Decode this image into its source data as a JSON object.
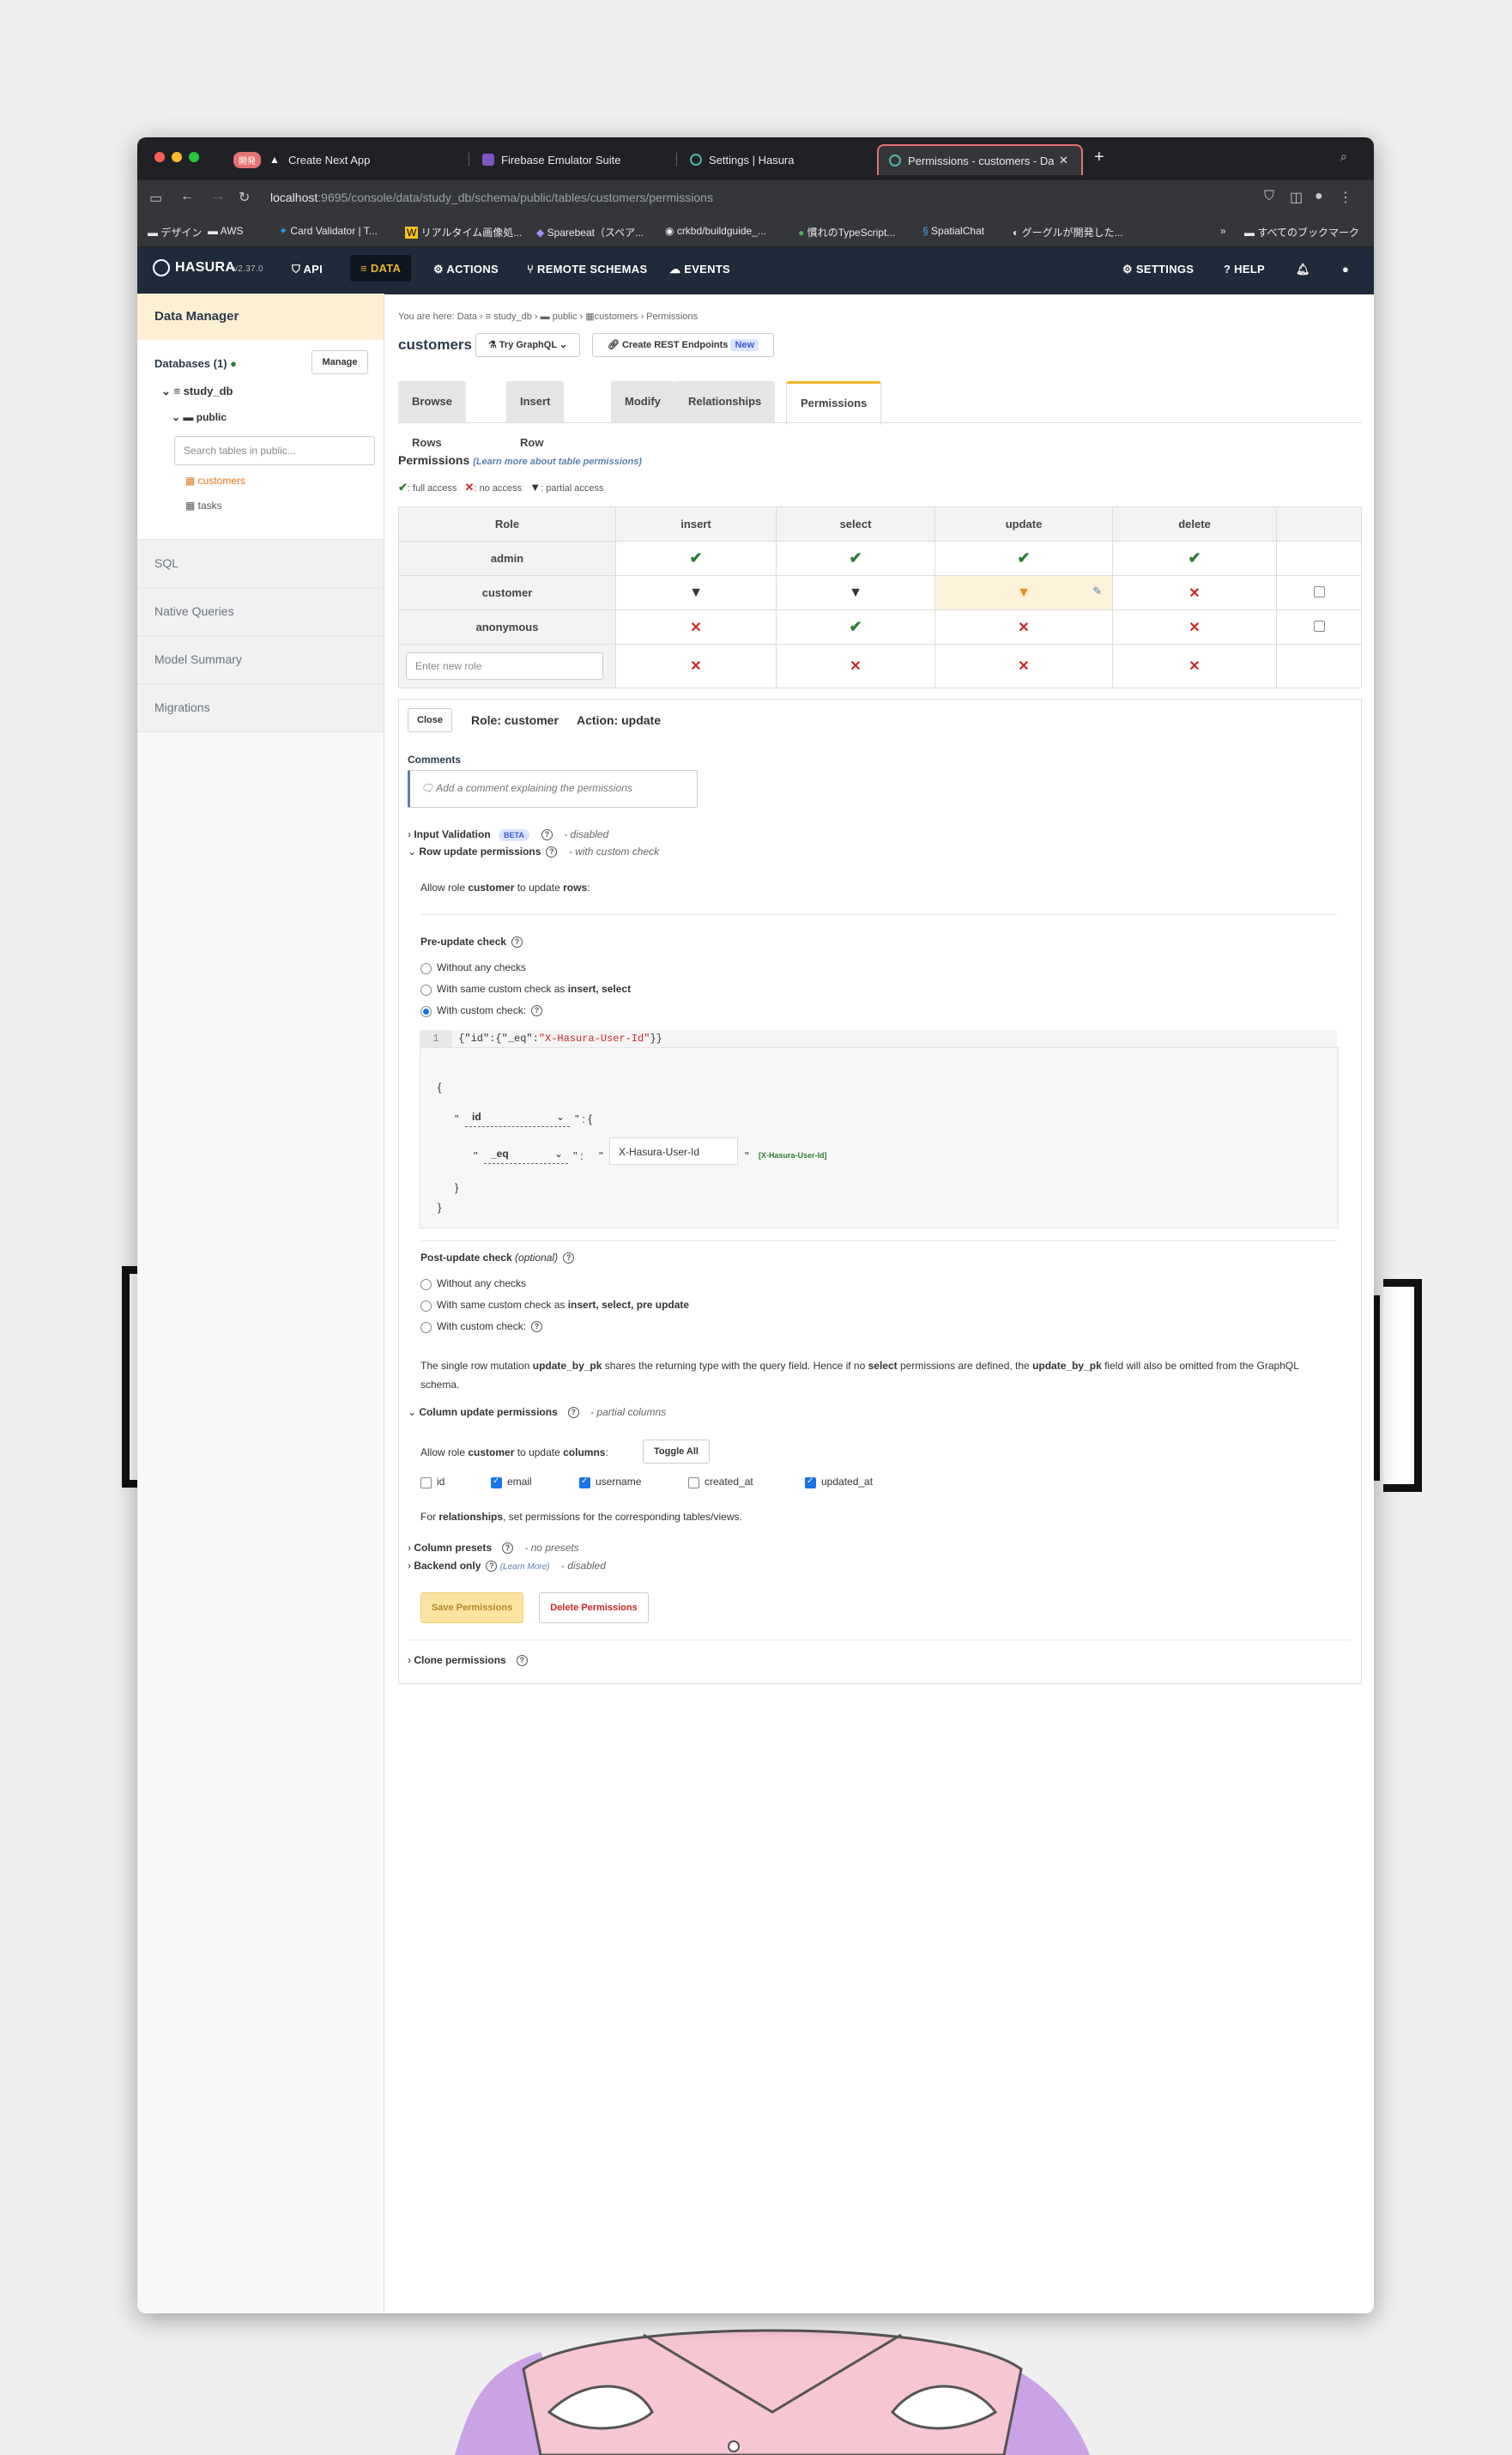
{
  "browser": {
    "tabs": [
      {
        "badge": "開発",
        "label": "Create Next App"
      },
      {
        "label": "Firebase Emulator Suite"
      },
      {
        "label": "Settings | Hasura"
      },
      {
        "label": "Permissions - customers - Da"
      }
    ],
    "new_tab": "+",
    "url_host": "localhost",
    "url_path": ":9695/console/data/study_db/schema/public/tables/customers/permissions",
    "bookmarks": [
      "デザイン",
      "AWS",
      "Card Validator | T...",
      "リアルタイム画像処...",
      "Sparebeat（スペア...",
      "crkbd/buildguide_...",
      "慣れのTypeScript...",
      "SpatialChat",
      "グーグルが開発した..."
    ],
    "bookmarks_overflow": "»",
    "all_bookmarks": "すべてのブックマーク"
  },
  "hasura_nav": {
    "logo": "HASURA",
    "version": "v2.37.0",
    "items": [
      "API",
      "DATA",
      "ACTIONS",
      "REMOTE SCHEMAS",
      "EVENTS"
    ],
    "right_items": [
      "SETTINGS",
      "HELP"
    ]
  },
  "sidebar": {
    "title": "Data Manager",
    "databases_label": "Databases (1)",
    "manage": "Manage",
    "db": "study_db",
    "schema": "public",
    "search_placeholder": "Search tables in public...",
    "tables": [
      "customers",
      "tasks"
    ],
    "sections": [
      "SQL",
      "Native Queries",
      "Model Summary",
      "Migrations"
    ]
  },
  "breadcrumb": {
    "prefix": "You are here: Data",
    "items": [
      "study_db",
      "public",
      "customers",
      "Permissions"
    ]
  },
  "page": {
    "title": "customers",
    "try_graphql": "Try GraphQL",
    "create_rest": "Create REST Endpoints",
    "new_badge": "New",
    "tabs": [
      "Browse Rows",
      "Insert Row",
      "Modify",
      "Relationships",
      "Permissions"
    ]
  },
  "permissions": {
    "heading": "Permissions",
    "learn_more": "(Learn more about table permissions)",
    "legend": [
      ": full access",
      ": no access",
      ": partial access"
    ],
    "columns": [
      "Role",
      "insert",
      "select",
      "update",
      "delete"
    ],
    "rows": [
      {
        "role": "admin",
        "cells": [
          "full",
          "full",
          "full",
          "full"
        ]
      },
      {
        "role": "customer",
        "cells": [
          "partial",
          "partial",
          "partial",
          "none"
        ]
      },
      {
        "role": "anonymous",
        "cells": [
          "none",
          "full",
          "none",
          "none"
        ]
      }
    ],
    "new_role_placeholder": "Enter new role",
    "new_role_cells": [
      "none",
      "none",
      "none",
      "none"
    ]
  },
  "editor": {
    "close": "Close",
    "role_label": "Role: customer",
    "action_label": "Action: update",
    "comments": "Comments",
    "comment_placeholder": "Add a comment explaining the permissions",
    "input_validation": "Input Validation",
    "beta": "BETA",
    "input_validation_status": "- disabled",
    "row_update": "Row update permissions",
    "row_update_status": "- with custom check",
    "allow_row": [
      "Allow role ",
      "customer",
      " to update ",
      "rows",
      ":"
    ],
    "pre_update": "Pre-update check",
    "pre_options": [
      "Without any checks",
      "With same custom check as ",
      "insert, select",
      "With custom check:"
    ],
    "code_line_no": "1",
    "code_a": "{\"id\":{\"_eq\":",
    "code_b": "\"X-Hasura-User-Id\"",
    "code_c": "}}",
    "builder": {
      "open1": "{",
      "field1": "id",
      "colon_open": "\" :  {",
      "field2": "_eq",
      "value": "X-Hasura-User-Id",
      "hint": "[X-Hasura-User-Id]",
      "close2": "}",
      "close1": "}"
    },
    "post_update": "Post-update check",
    "optional": "(optional)",
    "post_options": [
      "Without any checks",
      "With same custom check as ",
      "insert, select, pre update",
      "With custom check:"
    ],
    "note": [
      "The single row mutation ",
      "update_by_pk",
      " shares the returning type with the query field. Hence if no ",
      "select",
      " permissions are defined, the ",
      "update_by_pk",
      " field will also be omitted from the GraphQL schema."
    ],
    "column_update": "Column update permissions",
    "column_update_status": "- partial columns",
    "allow_cols": [
      "Allow role ",
      "customer",
      " to update ",
      "columns",
      ":"
    ],
    "toggle_all": "Toggle All",
    "columns": [
      {
        "name": "id",
        "checked": false
      },
      {
        "name": "email",
        "checked": true
      },
      {
        "name": "username",
        "checked": true
      },
      {
        "name": "created_at",
        "checked": false
      },
      {
        "name": "updated_at",
        "checked": true
      }
    ],
    "relationships_note": [
      "For ",
      "relationships",
      ", set permissions for the corresponding tables/views."
    ],
    "column_presets": "Column presets",
    "column_presets_status": "- no presets",
    "backend_only": "Backend only",
    "backend_learn": "(Learn More)",
    "backend_status": "- disabled",
    "save": "Save Permissions",
    "delete": "Delete Permissions",
    "clone": "Clone permissions"
  },
  "colors": {
    "accent": "#f0b429",
    "nav_bg": "#1f2a3a",
    "full": "#2e7d32",
    "none": "#c62828",
    "partial_highlight": "#fdf1da"
  }
}
